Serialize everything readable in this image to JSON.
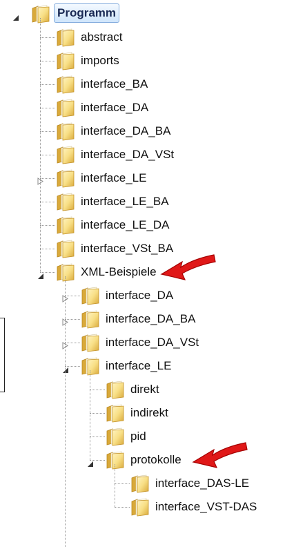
{
  "tree": {
    "root": {
      "label": "Programm",
      "expanded": true,
      "selected": true
    },
    "rows": [
      {
        "id": "programm",
        "label": "Programm",
        "level": 0,
        "expander": "open",
        "selected": true
      },
      {
        "id": "abstract",
        "label": "abstract",
        "level": 1,
        "expander": "none"
      },
      {
        "id": "imports",
        "label": "imports",
        "level": 1,
        "expander": "none"
      },
      {
        "id": "interface_BA",
        "label": "interface_BA",
        "level": 1,
        "expander": "none"
      },
      {
        "id": "interface_DA",
        "label": "interface_DA",
        "level": 1,
        "expander": "none"
      },
      {
        "id": "interface_DA_BA",
        "label": "interface_DA_BA",
        "level": 1,
        "expander": "none"
      },
      {
        "id": "interface_DA_VSt",
        "label": "interface_DA_VSt",
        "level": 1,
        "expander": "none"
      },
      {
        "id": "interface_LE",
        "label": "interface_LE",
        "level": 1,
        "expander": "closed"
      },
      {
        "id": "interface_LE_BA",
        "label": "interface_LE_BA",
        "level": 1,
        "expander": "none"
      },
      {
        "id": "interface_LE_DA",
        "label": "interface_LE_DA",
        "level": 1,
        "expander": "none"
      },
      {
        "id": "interface_VSt_BA",
        "label": "interface_VSt_BA",
        "level": 1,
        "expander": "none"
      },
      {
        "id": "xml_beispiele",
        "label": "XML-Beispiele",
        "level": 1,
        "expander": "open",
        "arrow": true
      },
      {
        "id": "xml_interface_DA",
        "label": "interface_DA",
        "level": 2,
        "expander": "closed"
      },
      {
        "id": "xml_interface_DA_BA",
        "label": "interface_DA_BA",
        "level": 2,
        "expander": "closed"
      },
      {
        "id": "xml_interface_DA_VSt",
        "label": "interface_DA_VSt",
        "level": 2,
        "expander": "closed"
      },
      {
        "id": "xml_interface_LE",
        "label": "interface_LE",
        "level": 2,
        "expander": "open"
      },
      {
        "id": "direkt",
        "label": "direkt",
        "level": 3,
        "expander": "none"
      },
      {
        "id": "indirekt",
        "label": "indirekt",
        "level": 3,
        "expander": "none"
      },
      {
        "id": "pid",
        "label": "pid",
        "level": 3,
        "expander": "none"
      },
      {
        "id": "protokolle",
        "label": "protokolle",
        "level": 3,
        "expander": "open",
        "arrow": true
      },
      {
        "id": "interface_DAS_LE",
        "label": "interface_DAS-LE",
        "level": 4,
        "expander": "none"
      },
      {
        "id": "interface_VST_DAS",
        "label": "interface_VST-DAS",
        "level": 4,
        "expander": "none"
      }
    ]
  },
  "colors": {
    "selection_border": "#84acdd",
    "selection_fill": "#cfe5fb",
    "folder_light": "#f8df86",
    "folder_dark": "#d9a93a",
    "arrow_red": "#e01818"
  },
  "icons": {
    "folder": "folder-icon",
    "expanded": "expanded-triangle-icon",
    "collapsed": "collapsed-triangle-icon",
    "annotation": "red-arrow-icon"
  }
}
